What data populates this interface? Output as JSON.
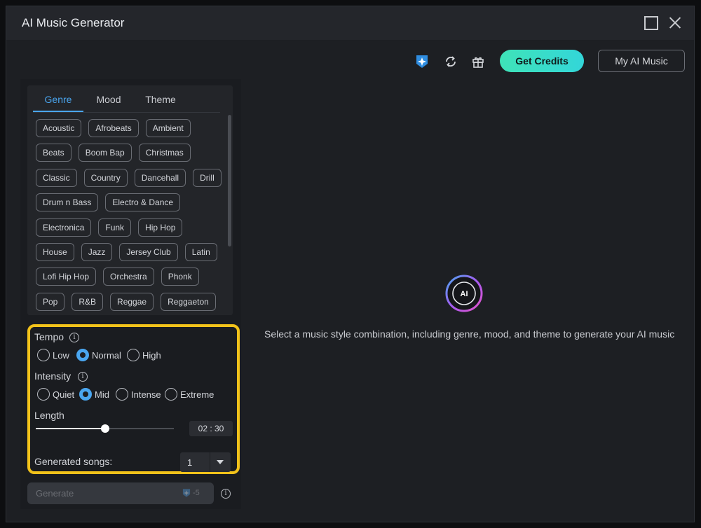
{
  "window": {
    "title": "AI Music Generator"
  },
  "toolbar": {
    "icons": [
      "credit-icon",
      "refresh-icon",
      "gift-icon"
    ],
    "get_credits": "Get Credits",
    "my_ai_music": "My AI Music",
    "accent": "#3fe3b8"
  },
  "tabs": [
    {
      "label": "Genre",
      "active": true
    },
    {
      "label": "Mood",
      "active": false
    },
    {
      "label": "Theme",
      "active": false
    }
  ],
  "genre_rows": [
    [
      "Acoustic",
      "Afrobeats",
      "Ambient"
    ],
    [
      "Beats",
      "Boom Bap",
      "Christmas"
    ],
    [
      "Classic",
      "Country",
      "Dancehall",
      "Drill"
    ],
    [
      "Drum n Bass",
      "Electro & Dance"
    ],
    [
      "Electronica",
      "Funk",
      "Hip Hop"
    ],
    [
      "House",
      "Jazz",
      "Jersey Club",
      "Latin"
    ],
    [
      "Lofi Hip Hop",
      "Orchestra",
      "Phonk"
    ],
    [
      "Pop",
      "R&B",
      "Reggae",
      "Reggaeton"
    ]
  ],
  "tempo": {
    "label": "Tempo",
    "options": [
      "Low",
      "Normal",
      "High"
    ],
    "selected": "Normal"
  },
  "intensity": {
    "label": "Intensity",
    "options": [
      "Quiet",
      "Mid",
      "Intense",
      "Extreme"
    ],
    "selected": "Mid"
  },
  "length": {
    "label": "Length",
    "value": "02 : 30",
    "fraction": 0.5
  },
  "generated_songs": {
    "label": "Generated songs:",
    "value": "1"
  },
  "generate": {
    "label": "Generate",
    "cost": "-5"
  },
  "main": {
    "logo_text": "AI",
    "hint": "Select a music style combination, including genre, mood, and theme to generate your AI music"
  },
  "colors": {
    "highlight_border": "#f2c21a",
    "selected": "#4aa6f0"
  }
}
